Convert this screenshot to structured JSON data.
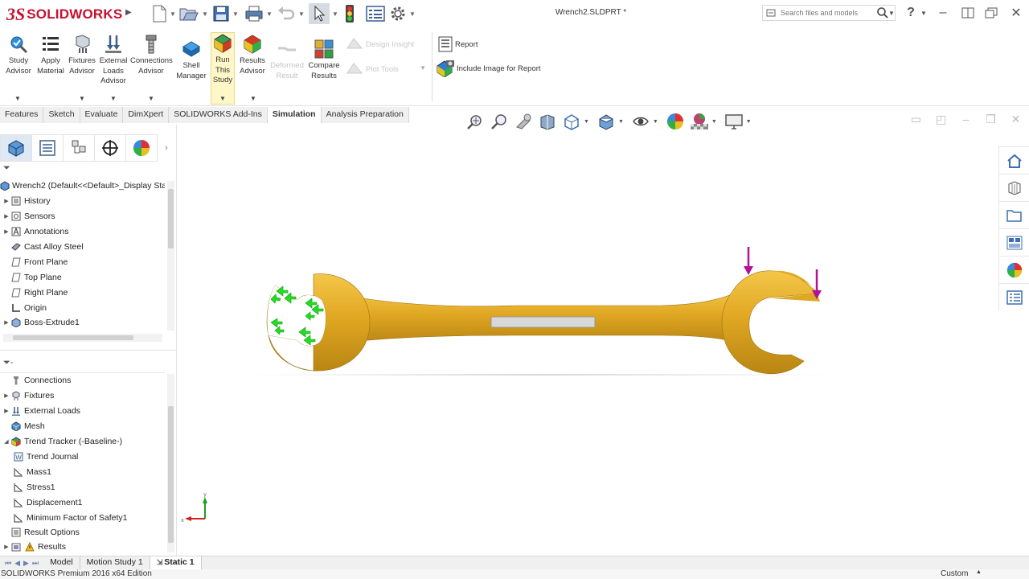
{
  "app": {
    "logo_ds": "3S",
    "logo_text": "SOLIDWORKS",
    "doc_title": "Wrench2.SLDPRT *",
    "search_placeholder": "Search files and models"
  },
  "ribbon": {
    "buttons": [
      {
        "label1": "Study",
        "label2": "Advisor",
        "label3": ""
      },
      {
        "label1": "Apply",
        "label2": "Material",
        "label3": ""
      },
      {
        "label1": "Fixtures",
        "label2": "Advisor",
        "label3": ""
      },
      {
        "label1": "External",
        "label2": "Loads",
        "label3": "Advisor"
      },
      {
        "label1": "Connections",
        "label2": "Advisor",
        "label3": ""
      },
      {
        "label1": "Shell",
        "label2": "Manager",
        "label3": ""
      },
      {
        "label1": "Run",
        "label2": "This",
        "label3": "Study"
      },
      {
        "label1": "Results",
        "label2": "Advisor",
        "label3": ""
      },
      {
        "label1": "Deformed",
        "label2": "Result",
        "label3": ""
      },
      {
        "label1": "Compare",
        "label2": "Results",
        "label3": ""
      }
    ],
    "design_insight": "Design Insight",
    "plot_tools": "Plot Tools",
    "report": "Report",
    "include_image": "Include Image for Report"
  },
  "cm_tabs": [
    "Features",
    "Sketch",
    "Evaluate",
    "DimXpert",
    "SOLIDWORKS Add-Ins",
    "Simulation",
    "Analysis Preparation"
  ],
  "feature_tree": {
    "root": "Wrench2  (Default<<Default>_Display Stat",
    "items": [
      "History",
      "Sensors",
      "Annotations",
      "Cast Alloy Steel",
      "Front Plane",
      "Top Plane",
      "Right Plane",
      "Origin",
      "Boss-Extrude1"
    ]
  },
  "sim_tree": {
    "filter": "-",
    "items": [
      "Connections",
      "Fixtures",
      "External Loads",
      "Mesh",
      "Trend Tracker (-Baseline-)",
      "Trend Journal",
      "Mass1",
      "Stress1",
      "Displacement1",
      "Minimum Factor of Safety1",
      "Result Options",
      "Results"
    ]
  },
  "axes": {
    "x": "x",
    "y": "y"
  },
  "bottom_tabs": [
    "Model",
    "Motion Study 1",
    "Static 1"
  ],
  "status": {
    "edition": "SOLIDWORKS Premium 2016 x64 Edition",
    "units": "Custom"
  },
  "colors": {
    "wrench": "#e0a722",
    "fixture": "#22dd22",
    "load": "#b0109a",
    "brand": "#c8102e"
  }
}
